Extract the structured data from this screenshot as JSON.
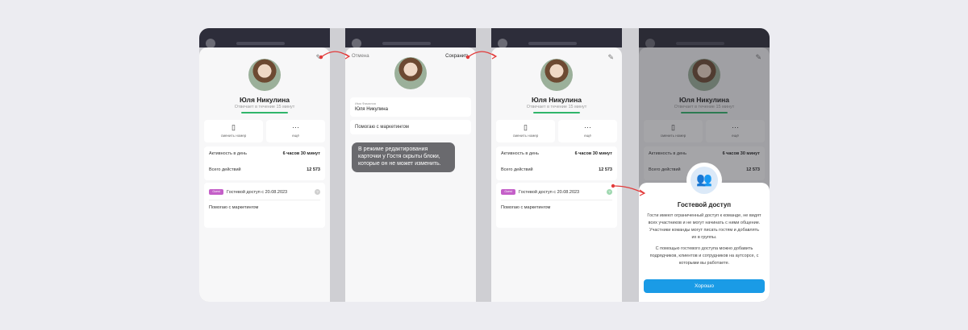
{
  "profile": {
    "name": "Юля Никулина",
    "status": "Отвечает в течение 15 минут",
    "edit_icon": "pencil-icon"
  },
  "actions": [
    {
      "icon": "phone-icon",
      "label": "сменить номер"
    },
    {
      "icon": "more-icon",
      "label": "ещё"
    }
  ],
  "stats": [
    {
      "label": "Активность в день",
      "value": "6 часов 30 минут"
    },
    {
      "label": "Всего действий",
      "value": "12 573"
    }
  ],
  "guest": {
    "badge": "Guest",
    "text": "Гостевой доступ с 20.08.2023",
    "description": "Помогаю с маркетингом"
  },
  "edit_mode": {
    "cancel": "Отмена",
    "save": "Сохранить",
    "field_label": "Имя Фамилия",
    "field_value": "Юля Никулина",
    "description": "Помогаю с маркетингом",
    "tooltip": "В режиме редактирования карточки у Гостя скрыты блоки, которые он не может изменить."
  },
  "modal": {
    "title": "Гостевой доступ",
    "text1": "Гости имеют ограниченный доступ к команде, не видят всех участников и не могут начинать с ними общение. Участники команды могут писать гостям и добавлять их в группы.",
    "text2": "С помощью гостевого доступа можно добавить подрядчиков, клиентов и сотрудников на аутсорсе, с которыми вы работаете.",
    "ok": "Хорошо"
  },
  "colors": {
    "accent": "#1a9be6",
    "online": "#2fb56a",
    "guest_badge": "#c45fc8",
    "arrow": "#e23b3b"
  }
}
